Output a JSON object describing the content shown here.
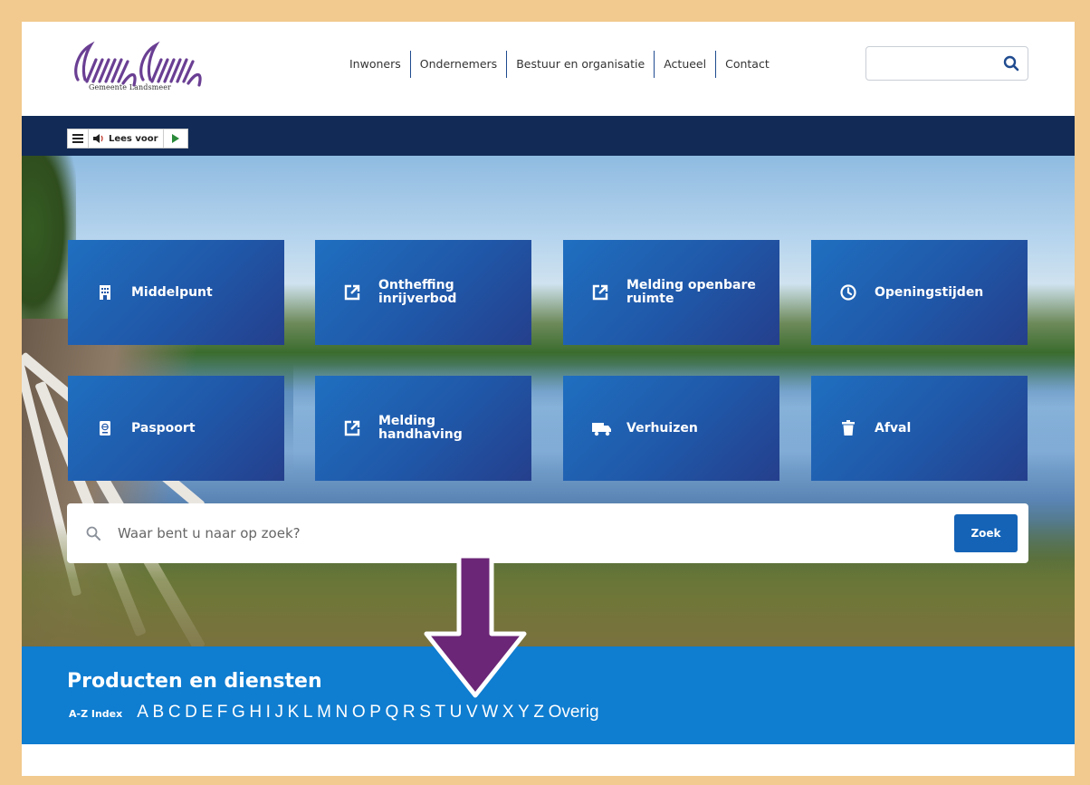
{
  "header": {
    "logo_text": "Gemeente Landsmeer",
    "nav": [
      "Inwoners",
      "Ondernemers",
      "Bestuur en organisatie",
      "Actueel",
      "Contact"
    ],
    "search_icon": "search-icon"
  },
  "toolbar": {
    "menu_icon": "menu-icon",
    "read_label": "Lees voor",
    "play_icon": "play-icon"
  },
  "tiles": [
    {
      "label": "Middelpunt",
      "icon": "building-icon"
    },
    {
      "label": "Ontheffing inrijverbod",
      "icon": "external-link-icon"
    },
    {
      "label": "Melding openbare ruimte",
      "icon": "external-link-icon"
    },
    {
      "label": "Openingstijden",
      "icon": "clock-icon"
    },
    {
      "label": "Paspoort",
      "icon": "passport-icon"
    },
    {
      "label": "Melding handhaving",
      "icon": "external-link-icon"
    },
    {
      "label": "Verhuizen",
      "icon": "truck-icon"
    },
    {
      "label": "Afval",
      "icon": "trash-icon"
    }
  ],
  "search": {
    "placeholder": "Waar bent u naar op zoek?",
    "button": "Zoek"
  },
  "products": {
    "title": "Producten en diensten",
    "index_label": "A-Z Index",
    "letters": [
      "A",
      "B",
      "C",
      "D",
      "E",
      "F",
      "G",
      "H",
      "I",
      "J",
      "K",
      "L",
      "M",
      "N",
      "O",
      "P",
      "Q",
      "R",
      "S",
      "T",
      "U",
      "V",
      "W",
      "X",
      "Y",
      "Z",
      "Overig"
    ]
  },
  "colors": {
    "frame": "#f2c98e",
    "navy": "#112a56",
    "tile": "#2057a8",
    "band": "#0f7dd0",
    "logo": "#6a3f93",
    "arrow": "#6b2677"
  }
}
